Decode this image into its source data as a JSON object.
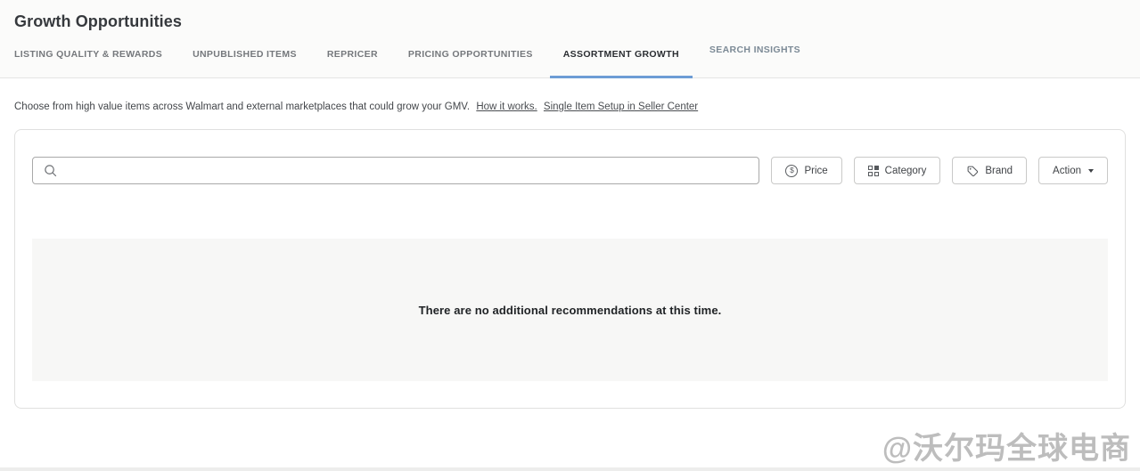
{
  "page": {
    "title": "Growth Opportunities"
  },
  "tabs": [
    {
      "label": "LISTING QUALITY & REWARDS",
      "active": false
    },
    {
      "label": "UNPUBLISHED ITEMS",
      "active": false
    },
    {
      "label": "REPRICER",
      "active": false
    },
    {
      "label": "PRICING OPPORTUNITIES",
      "active": false
    },
    {
      "label": "ASSORTMENT GROWTH",
      "active": true
    },
    {
      "label": "SEARCH INSIGHTS",
      "active": false
    }
  ],
  "description": {
    "text": "Choose from high value items across Walmart and external marketplaces that could grow your GMV.",
    "links": [
      {
        "label": "How it works."
      },
      {
        "label": "Single Item Setup in Seller Center"
      }
    ]
  },
  "toolbar": {
    "search": {
      "value": "",
      "placeholder": "",
      "icon": "search-icon"
    },
    "buttons": [
      {
        "label": "Price",
        "icon": "dollar-circle-icon"
      },
      {
        "label": "Category",
        "icon": "grid-icon"
      },
      {
        "label": "Brand",
        "icon": "tag-icon"
      },
      {
        "label": "Action",
        "icon": "caret-down-icon",
        "dropdown": true
      }
    ],
    "dollar_glyph": "$"
  },
  "empty_state": {
    "message": "There are no additional recommendations at this time."
  },
  "watermark": {
    "text": "@沃尔玛全球电商"
  },
  "colors": {
    "active_tab_underline": "#6d9cd5",
    "header_background": "#fbfbfa",
    "panel_background": "#f7f7f6",
    "card_border": "#e0e0df"
  }
}
